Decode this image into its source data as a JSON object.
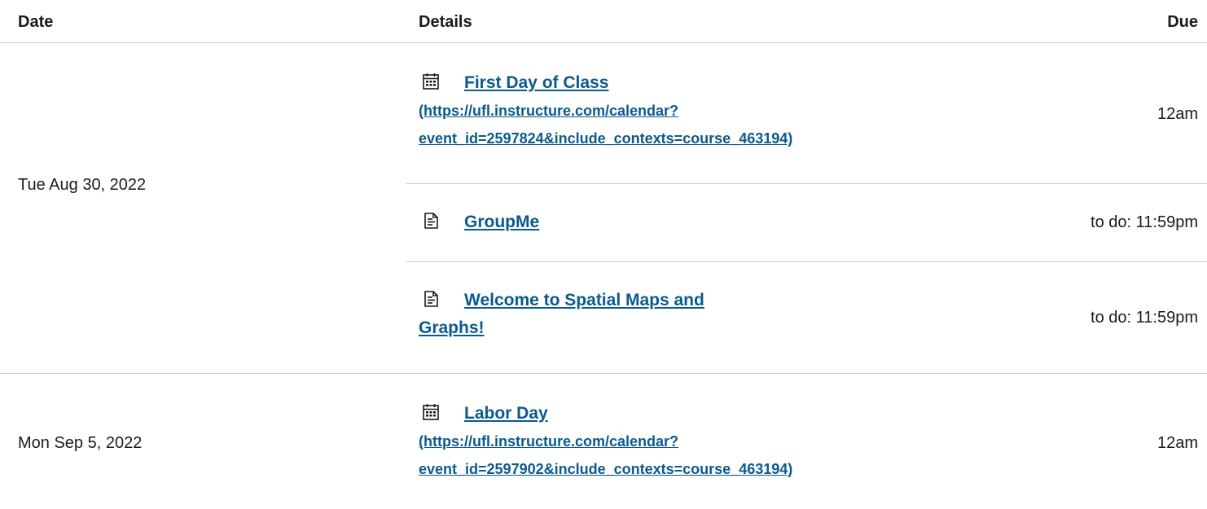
{
  "table": {
    "headers": {
      "date": "Date",
      "details": "Details",
      "due": "Due"
    },
    "groups": [
      {
        "date": "Tue Aug 30, 2022",
        "items": [
          {
            "icon": "calendar-icon",
            "title": "First Day of Class",
            "url_line1": "(https://ufl.instructure.com/calendar?",
            "url_line2": "event_id=2597824&include_contexts=course_463194)",
            "due": "12am"
          },
          {
            "icon": "document-icon",
            "title": "GroupMe",
            "due": "to do: 11:59pm"
          },
          {
            "icon": "document-icon",
            "title_line1": "Welcome to Spatial Maps and",
            "title_line2": "Graphs!",
            "due": "to do: 11:59pm"
          }
        ]
      },
      {
        "date": "Mon Sep 5, 2022",
        "items": [
          {
            "icon": "calendar-icon",
            "title": "Labor Day",
            "url_line1": "(https://ufl.instructure.com/calendar?",
            "url_line2": "event_id=2597902&include_contexts=course_463194)",
            "due": "12am"
          }
        ]
      }
    ]
  },
  "colors": {
    "link": "#0a5a8e",
    "text": "#1b1b1b",
    "divider": "#c7cdd1"
  }
}
